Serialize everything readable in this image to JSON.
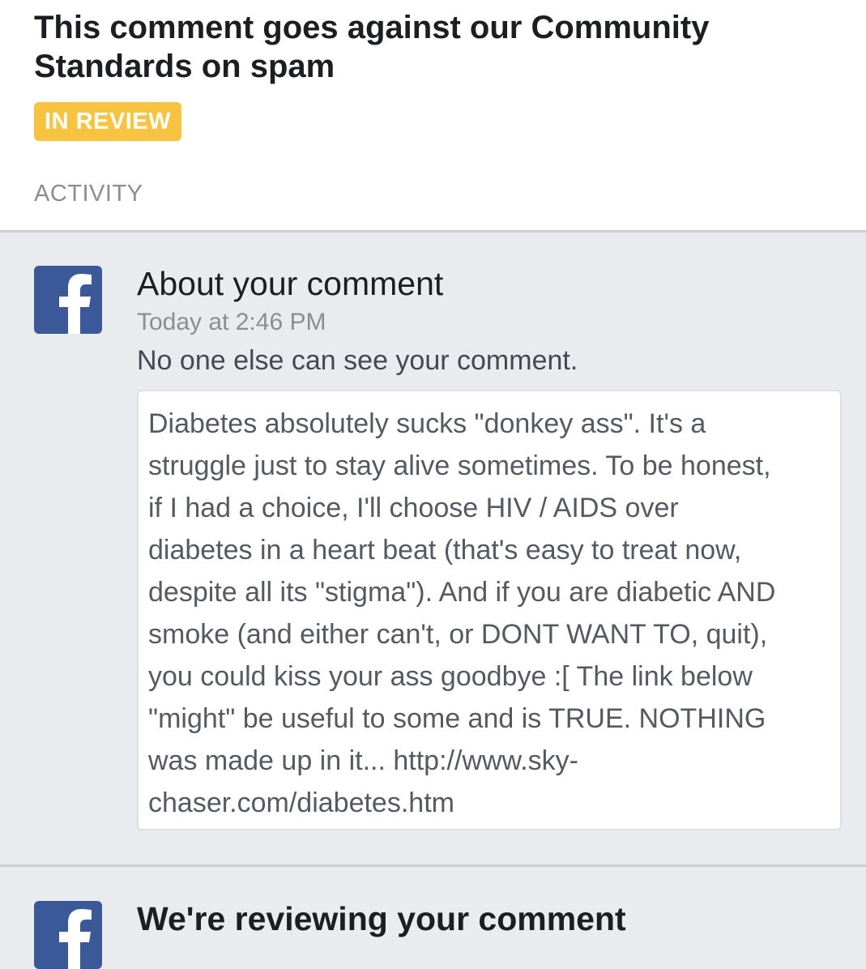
{
  "header": {
    "title": "This comment goes against our Community Standards on spam",
    "status": "IN REVIEW",
    "section_label": "ACTIVITY"
  },
  "colors": {
    "status_badge": "#f7c340",
    "facebook_brand": "#3b5998",
    "page_background": "#e9ebee"
  },
  "activity": [
    {
      "icon": "facebook-icon",
      "title": "About your comment",
      "time": "Today at 2:46 PM",
      "message": "No one else can see your comment.",
      "comment": "Diabetes absolutely sucks \"donkey ass\". It's a\nstruggle just to stay alive sometimes. To be honest,\nif I had a choice, I'll choose HIV / AIDS over\ndiabetes in a heart beat (that's easy to treat now,\ndespite all its \"stigma\"). And if you are diabetic AND\nsmoke (and either can't, or DONT WANT TO, quit),\nyou could kiss your ass goodbye :[ The link below\n\"might\" be useful to some and is TRUE. NOTHING\nwas made up in it... http://www.sky-\nchaser.com/diabetes.htm"
    },
    {
      "icon": "facebook-icon",
      "title": "We're reviewing your comment"
    }
  ]
}
